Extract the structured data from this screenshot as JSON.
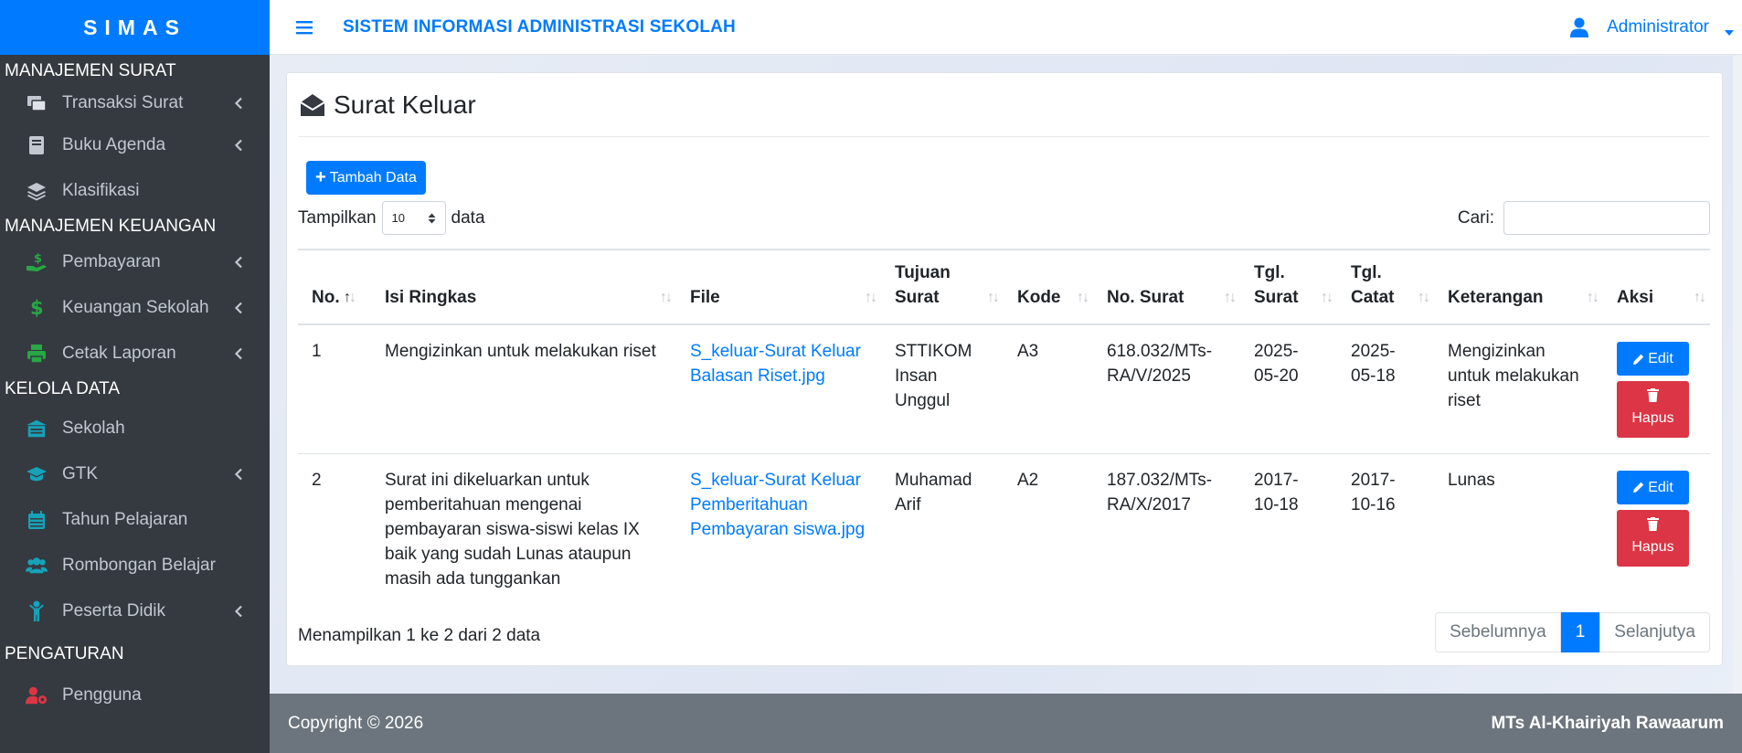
{
  "brand": "SIMAS",
  "header": {
    "title": "SISTEM INFORMASI ADMINISTRASI SEKOLAH",
    "user": "Administrator"
  },
  "sidebar": {
    "sections": [
      {
        "title": "MANAJEMEN SURAT",
        "items": [
          {
            "label": "Transaksi Surat",
            "icon": "envelopes-icon",
            "has_sub": true
          },
          {
            "label": "Buku Agenda",
            "icon": "book-icon",
            "has_sub": true
          },
          {
            "label": "Klasifikasi",
            "icon": "layers-icon",
            "has_sub": false
          }
        ]
      },
      {
        "title": "MANAJEMEN KEUANGAN",
        "items": [
          {
            "label": "Pembayaran",
            "icon": "hand-dollar-icon",
            "has_sub": true
          },
          {
            "label": "Keuangan Sekolah",
            "icon": "dollar-icon",
            "has_sub": true
          },
          {
            "label": "Cetak Laporan",
            "icon": "printer-icon",
            "has_sub": true
          }
        ]
      },
      {
        "title": "KELOLA DATA",
        "items": [
          {
            "label": "Sekolah",
            "icon": "school-icon",
            "has_sub": false
          },
          {
            "label": "GTK",
            "icon": "graduation-cap-icon",
            "has_sub": true
          },
          {
            "label": "Tahun Pelajaran",
            "icon": "calendar-icon",
            "has_sub": false
          },
          {
            "label": "Rombongan Belajar",
            "icon": "users-icon",
            "has_sub": false
          },
          {
            "label": "Peserta Didik",
            "icon": "child-icon",
            "has_sub": true
          }
        ]
      },
      {
        "title": "PENGATURAN",
        "items": [
          {
            "label": "Pengguna",
            "icon": "user-cog-icon",
            "has_sub": false
          }
        ]
      }
    ]
  },
  "page": {
    "title": "Surat Keluar",
    "add_label": "Tambah Data",
    "length_prefix": "Tampilkan",
    "length_value": "10",
    "length_suffix": "data",
    "search_label": "Cari:",
    "search_value": ""
  },
  "table": {
    "columns": [
      "No.",
      "Isi Ringkas",
      "File",
      "Tujuan Surat",
      "Kode",
      "No. Surat",
      "Tgl. Surat",
      "Tgl. Catat",
      "Keterangan",
      "Aksi"
    ],
    "rows": [
      {
        "no": "1",
        "isi": "Mengizinkan untuk melakukan riset",
        "file": "S_keluar-Surat Keluar Balasan Riset.jpg",
        "tujuan": "STTIKOM Insan Unggul",
        "kode": "A3",
        "nosurat": "618.032/MTs-RA/V/2025",
        "tgl_surat": "2025-05-20",
        "tgl_catat": "2025-05-18",
        "ket": "Mengizinkan untuk melakukan riset"
      },
      {
        "no": "2",
        "isi": "Surat ini dikeluarkan untuk pemberitahuan mengenai pembayaran siswa-siswi kelas IX baik yang sudah Lunas ataupun masih ada tunggankan",
        "file": "S_keluar-Surat Keluar Pemberitahuan Pembayaran siswa.jpg",
        "tujuan": "Muhamad Arif",
        "kode": "A2",
        "nosurat": "187.032/MTs-RA/X/2017",
        "tgl_surat": "2017-10-18",
        "tgl_catat": "2017-10-16",
        "ket": "Lunas"
      }
    ],
    "edit_label": "Edit",
    "delete_label": "Hapus"
  },
  "pagination": {
    "info": "Menampilkan 1 ke 2 dari 2 data",
    "prev": "Sebelumnya",
    "current": "1",
    "next": "Selanjutya"
  },
  "footer": {
    "left": "Copyright © 2026",
    "right": "MTs Al-Khairiyah Rawaarum"
  },
  "colors": {
    "primary": "#007bff",
    "danger": "#dc3545",
    "sidebar": "#343a40",
    "footer": "#6c757d"
  }
}
